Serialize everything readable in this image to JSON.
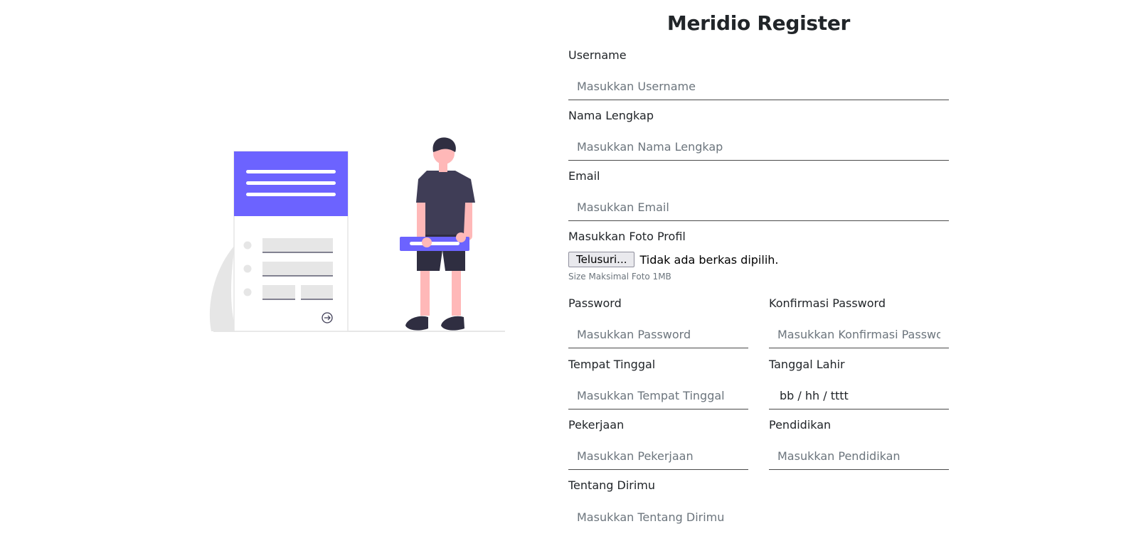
{
  "title": "Meridio Register",
  "colors": {
    "accent": "#6c63ff",
    "dark": "#3f3d56",
    "skin": "#ffb8b8",
    "light_gray": "#e6e6e6"
  },
  "fields": {
    "username": {
      "label": "Username",
      "placeholder": "Masukkan Username"
    },
    "fullname": {
      "label": "Nama Lengkap",
      "placeholder": "Masukkan Nama Lengkap"
    },
    "email": {
      "label": "Email",
      "placeholder": "Masukkan Email"
    },
    "photo": {
      "label": "Masukkan Foto Profil",
      "button": "Telusuri...",
      "status": "Tidak ada berkas dipilih.",
      "hint": "Size Maksimal Foto 1MB"
    },
    "password": {
      "label": "Password",
      "placeholder": "Masukkan Password"
    },
    "confirm_password": {
      "label": "Konfirmasi Password",
      "placeholder": "Masukkan Konfirmasi Password"
    },
    "residence": {
      "label": "Tempat Tinggal",
      "placeholder": "Masukkan Tempat Tinggal"
    },
    "birthdate": {
      "label": "Tanggal Lahir",
      "value": "bb / hh / tttt"
    },
    "job": {
      "label": "Pekerjaan",
      "placeholder": "Masukkan Pekerjaan"
    },
    "education": {
      "label": "Pendidikan",
      "placeholder": "Masukkan Pendidikan"
    },
    "about": {
      "label": "Tentang Dirimu",
      "placeholder": "Masukkan Tentang Dirimu"
    }
  },
  "illustration": {
    "icon": "register-illustration"
  }
}
